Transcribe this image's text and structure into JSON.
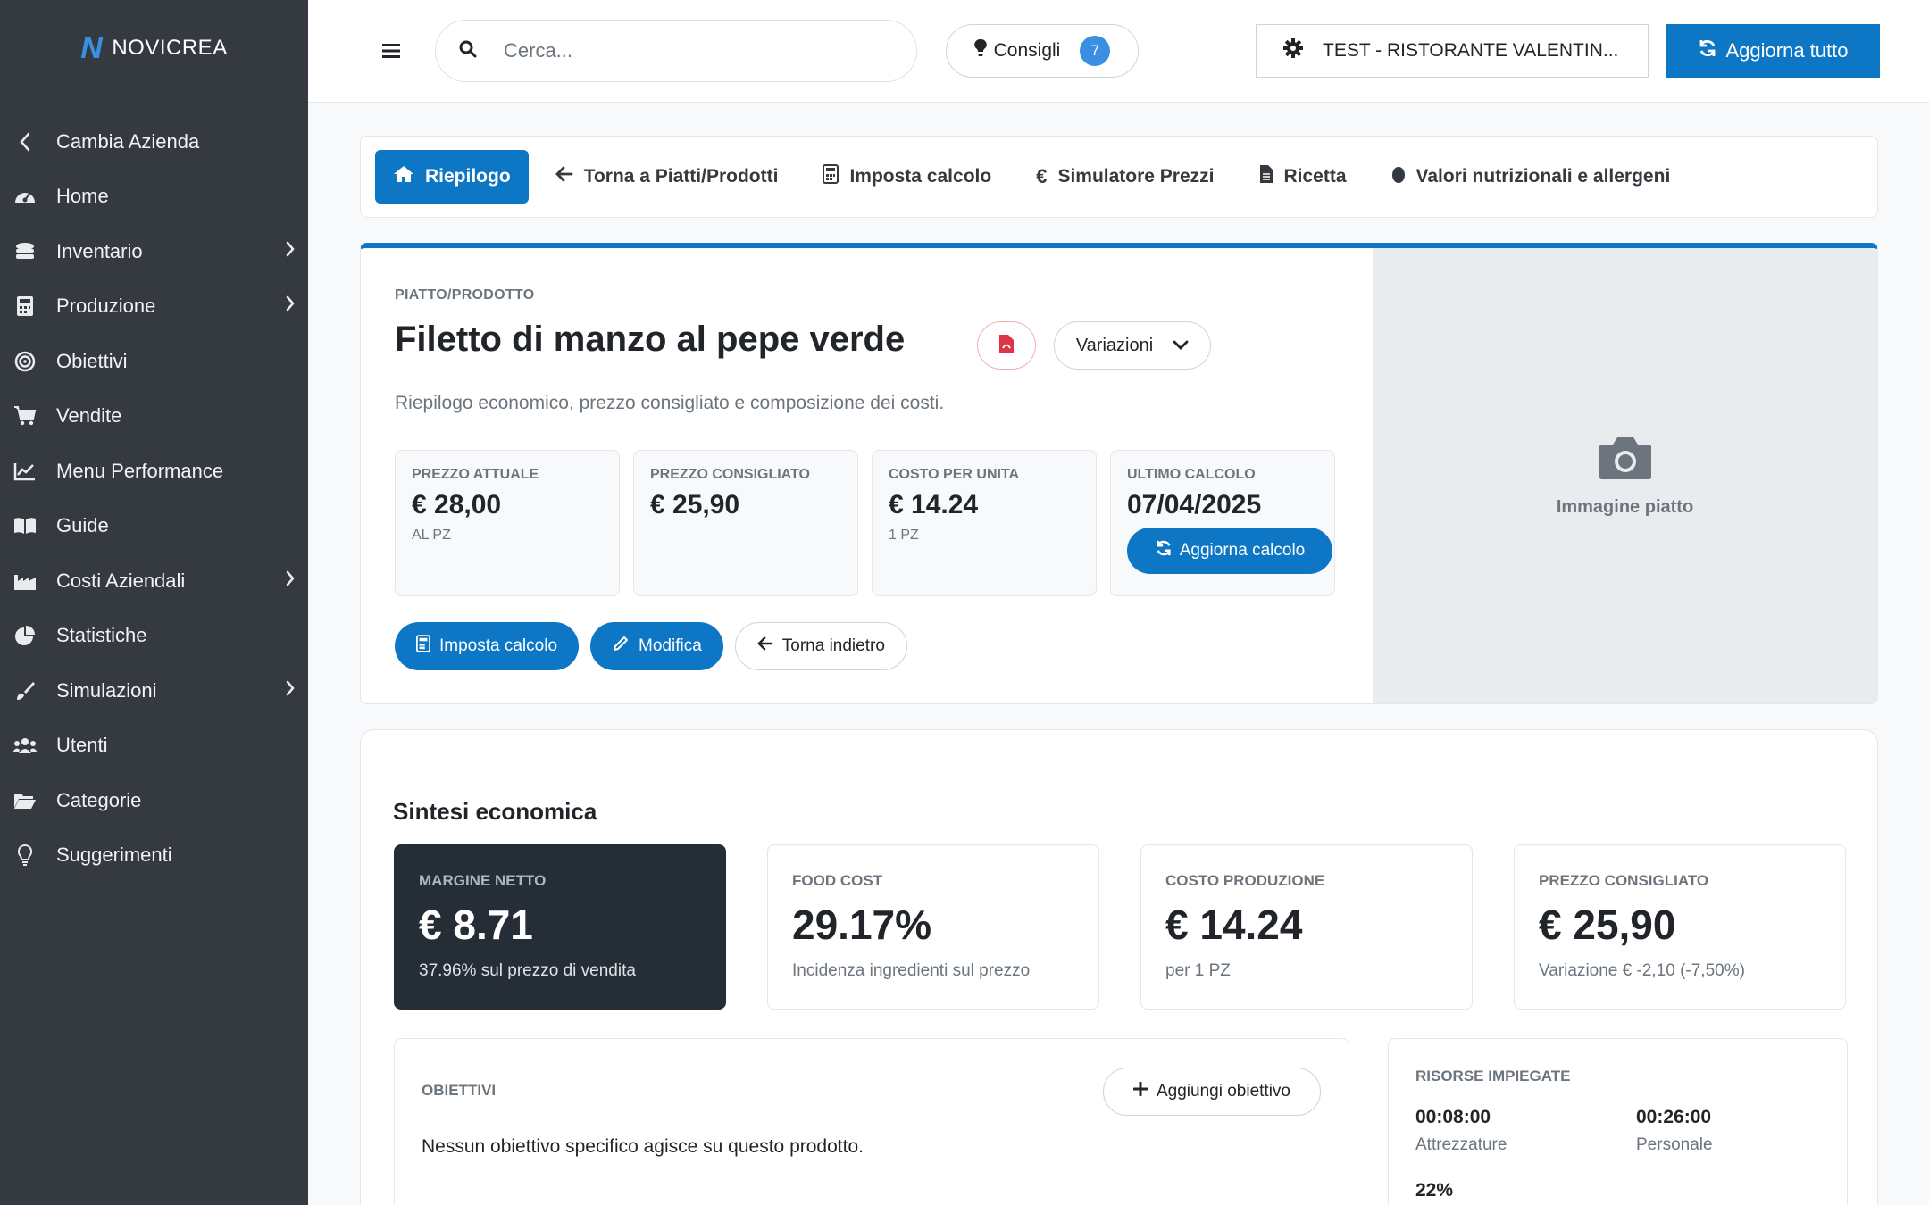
{
  "brand": {
    "logo": "N",
    "name": "NOVICREA"
  },
  "sidebar": {
    "items": [
      {
        "label": "Cambia Azienda",
        "icon": "chevron-left-icon",
        "sub": false
      },
      {
        "label": "Home",
        "icon": "dashboard-icon",
        "sub": false
      },
      {
        "label": "Inventario",
        "icon": "inventory-icon",
        "sub": true
      },
      {
        "label": "Produzione",
        "icon": "calculator-icon",
        "sub": true
      },
      {
        "label": "Obiettivi",
        "icon": "target-icon",
        "sub": false
      },
      {
        "label": "Vendite",
        "icon": "cart-icon",
        "sub": false
      },
      {
        "label": "Menu Performance",
        "icon": "line-chart-icon",
        "sub": false
      },
      {
        "label": "Guide",
        "icon": "book-icon",
        "sub": false
      },
      {
        "label": "Costi Aziendali",
        "icon": "industry-icon",
        "sub": true
      },
      {
        "label": "Statistiche",
        "icon": "pie-chart-icon",
        "sub": false
      },
      {
        "label": "Simulazioni",
        "icon": "brush-icon",
        "sub": true
      },
      {
        "label": "Utenti",
        "icon": "users-icon",
        "sub": false
      },
      {
        "label": "Categorie",
        "icon": "folder-icon",
        "sub": false
      },
      {
        "label": "Suggerimenti",
        "icon": "lightbulb-icon",
        "sub": false
      }
    ]
  },
  "topbar": {
    "search_placeholder": "Cerca...",
    "consigli_label": "Consigli",
    "consigli_count": "7",
    "company_label": "TEST - RISTORANTE VALENTIN...",
    "refresh_all_label": "Aggiorna tutto"
  },
  "tabs": [
    {
      "label": "Riepilogo",
      "active": true
    },
    {
      "label": "Torna a Piatti/Prodotti",
      "active": false
    },
    {
      "label": "Imposta calcolo",
      "active": false
    },
    {
      "label": "Simulatore Prezzi",
      "active": false
    },
    {
      "label": "Ricetta",
      "active": false
    },
    {
      "label": "Valori nutrizionali e allergeni",
      "active": false
    }
  ],
  "product": {
    "eyebrow": "PIATTO/PRODOTTO",
    "title": "Filetto di manzo al pepe verde",
    "variations_label": "Variazioni",
    "subtitle": "Riepilogo economico, prezzo consigliato e composizione dei costi.",
    "kpis": [
      {
        "label": "PREZZO ATTUALE",
        "value": "€ 28,00",
        "sub": "AL PZ"
      },
      {
        "label": "PREZZO CONSIGLIATO",
        "value": "€ 25,90",
        "sub": ""
      },
      {
        "label": "COSTO PER UNITA",
        "value": "€ 14.24",
        "sub": "1 PZ"
      },
      {
        "label": "ULTIMO CALCOLO",
        "value": "07/04/2025",
        "button": "Aggiorna calcolo"
      }
    ],
    "actions": {
      "imposta": "Imposta calcolo",
      "modifica": "Modifica",
      "indietro": "Torna indietro"
    },
    "image_label": "Immagine piatto"
  },
  "sintesi": {
    "title": "Sintesi economica",
    "cards": [
      {
        "label": "MARGINE NETTO",
        "value": "€ 8.71",
        "sub": "37.96% sul prezzo di vendita"
      },
      {
        "label": "FOOD COST",
        "value": "29.17%",
        "sub": "Incidenza ingredienti sul prezzo"
      },
      {
        "label": "COSTO PRODUZIONE",
        "value": "€ 14.24",
        "sub": "per 1 PZ"
      },
      {
        "label": "PREZZO CONSIGLIATO",
        "value": "€ 25,90",
        "sub": "Variazione € -2,10 (-7,50%)"
      }
    ],
    "obiettivi": {
      "label": "OBIETTIVI",
      "button": "Aggiungi obiettivo",
      "text": "Nessun obiettivo specifico agisce su questo prodotto."
    },
    "risorse": {
      "label": "RISORSE IMPIEGATE",
      "attrezzature_value": "00:08:00",
      "attrezzature_label": "Attrezzature",
      "personale_value": "00:26:00",
      "personale_label": "Personale",
      "percent": "22%"
    }
  },
  "colors": {
    "primary": "#0d76c5",
    "sidebar": "#343a40",
    "dark_card": "#252d36",
    "badge": "#3b8fe3",
    "pdf": "#dc3545"
  }
}
